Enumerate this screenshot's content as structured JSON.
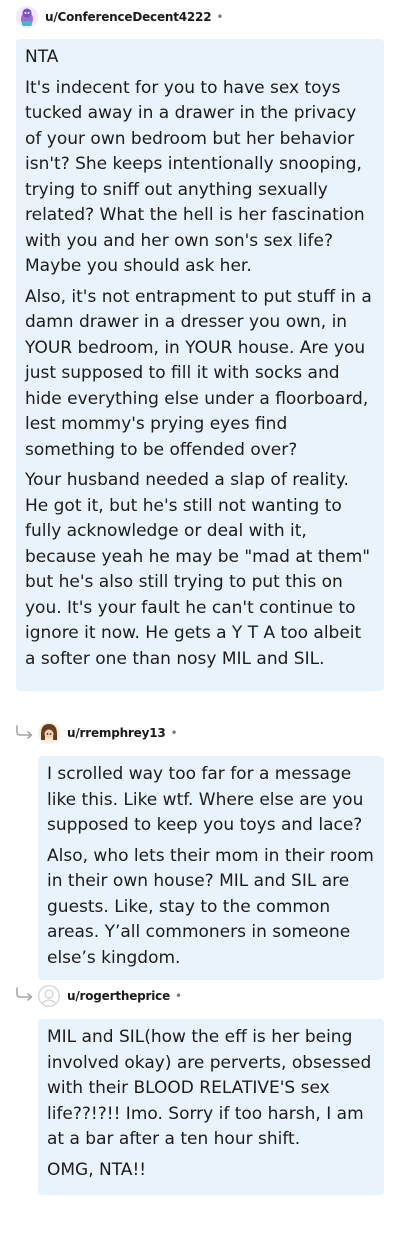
{
  "comments": [
    {
      "username": "u/ConferenceDecent4222",
      "separator": "•",
      "paragraphs": [
        "NTA",
        "It's indecent for you to have sex toys tucked away in a drawer in the privacy of your own bedroom but her behavior isn't? She keeps intentionally snooping, trying to sniff out anything sexually related? What the hell is her fascination with you and her own son's sex life? Maybe you should ask her.",
        "Also, it's not entrapment to put stuff in a damn drawer in a dresser you own, in YOUR bedroom, in YOUR house. Are you just supposed to fill it with socks and hide everything else under a floorboard, lest mommy's prying eyes find something to be offended over?",
        "Your husband needed a slap of reality. He got it, but he's still not wanting to fully acknowledge or deal with it, because yeah he may be \"mad at them\" but he's also still trying to put this on you. It's your fault he can't continue to ignore it now. He gets a Y T A too albeit a softer one than nosy MIL and SIL."
      ]
    },
    {
      "username": "u/rremphrey13",
      "separator": "•",
      "paragraphs": [
        "I scrolled way too far for a message like this. Like wtf. Where else are you supposed to keep you toys and lace?",
        "Also, who lets their mom in their room in their own house? MIL and SIL are guests. Like, stay to the common areas. Y’all commoners in someone else’s kingdom."
      ]
    },
    {
      "username": "u/rogertheprice",
      "separator": "•",
      "paragraphs": [
        "MIL and SIL(how the eff is her being involved okay) are perverts, obsessed with their BLOOD RELATIVE'S sex life??!?!! Imo. Sorry if too harsh, I am at a bar after a ten hour shift.",
        "OMG, NTA!!"
      ]
    }
  ],
  "colors": {
    "bubble": "#e8f3fb",
    "text": "#1c1c1c",
    "username": "#1a1a1b",
    "muted": "#7c7c7c"
  },
  "icons": {
    "reply_arrow": "reply-arrow-icon",
    "avatars": [
      "snoo-avatar-purple-icon",
      "snoo-avatar-brown-hair-icon",
      "default-avatar-outline-icon"
    ]
  }
}
